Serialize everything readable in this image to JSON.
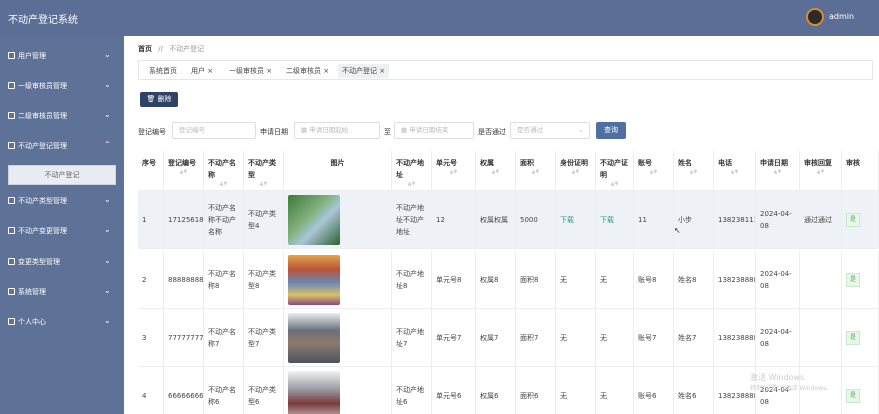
{
  "app": {
    "title": "不动产登记系统",
    "user": "admin"
  },
  "sidebar": {
    "items": [
      {
        "label": "用户管理",
        "icon": "folder-icon",
        "chevron": "⌄"
      },
      {
        "label": "一级审核员管理",
        "icon": "check-icon",
        "chevron": "⌄"
      },
      {
        "label": "二级审核员管理",
        "icon": "check-icon",
        "chevron": "⌄"
      },
      {
        "label": "不动产登记管理",
        "icon": "check-icon",
        "chevron": "⌃"
      },
      {
        "label": "不动产类型管理",
        "icon": "grid-icon",
        "chevron": "⌄"
      },
      {
        "label": "不动产变更管理",
        "icon": "grid-icon",
        "chevron": "⌄"
      },
      {
        "label": "变更类型管理",
        "icon": "grid-icon",
        "chevron": "⌄"
      },
      {
        "label": "系统管理",
        "icon": "grid-icon",
        "chevron": "⌄"
      },
      {
        "label": "个人中心",
        "icon": "grid-icon",
        "chevron": "⌄"
      }
    ],
    "submenu_active": "不动产登记"
  },
  "breadcrumb": {
    "home": "首页",
    "sep": "//",
    "current": "不动产登记"
  },
  "tabs": [
    "系统首页",
    "用户 ×",
    "一级审核员 ×",
    "二级审核员 ×",
    "不动产登记 ×"
  ],
  "toolbar": {
    "delete_label": "删除"
  },
  "search": {
    "label_code": "登记编号",
    "ph_code": "登记编号",
    "label_date": "申请日期",
    "ph_date_start": "申请日期起始",
    "label_to": "至",
    "ph_date_end": "申请日期结束",
    "label_pass": "是否通过",
    "ph_pass": "是否通过",
    "query_label": "查询"
  },
  "table": {
    "headers": [
      "序号",
      "登记编号",
      "不动产名称",
      "不动产类型",
      "图片",
      "不动产地址",
      "单元号",
      "权属",
      "面积",
      "身份证明",
      "不动产证明",
      "账号",
      "姓名",
      "电话",
      "申请日期",
      "审核回复",
      "审核"
    ],
    "rows": [
      {
        "idx": "1",
        "code": "1712561885991",
        "name": "不动产名称不动产名称",
        "type": "不动产类型4",
        "addr": "不动产地址不动产地址",
        "unit": "12",
        "owner": "权属权属",
        "area": "5000",
        "idcard": "下载",
        "cert": "下载",
        "account": "11",
        "person": "小步",
        "phone": "13823811111",
        "date": "2024-04-08",
        "reply": "通过通过",
        "status": "是"
      },
      {
        "idx": "2",
        "code": "8888888888",
        "name": "不动产名称8",
        "type": "不动产类型8",
        "addr": "不动产地址8",
        "unit": "单元号8",
        "owner": "权属8",
        "area": "面积8",
        "idcard": "无",
        "cert": "无",
        "account": "账号8",
        "person": "姓名8",
        "phone": "13823888888",
        "date": "2024-04-08",
        "reply": "",
        "status": "是"
      },
      {
        "idx": "3",
        "code": "7777777777",
        "name": "不动产名称7",
        "type": "不动产类型7",
        "addr": "不动产地址7",
        "unit": "单元号7",
        "owner": "权属7",
        "area": "面积7",
        "idcard": "无",
        "cert": "无",
        "account": "账号7",
        "person": "姓名7",
        "phone": "13823888887",
        "date": "2024-04-08",
        "reply": "",
        "status": "是"
      },
      {
        "idx": "4",
        "code": "6666666666",
        "name": "不动产名称6",
        "type": "不动产类型6",
        "addr": "不动产地址6",
        "unit": "单元号6",
        "owner": "权属6",
        "area": "面积6",
        "idcard": "无",
        "cert": "无",
        "account": "账号6",
        "person": "姓名6",
        "phone": "13823888886",
        "date": "2024-04-08",
        "reply": "",
        "status": "是"
      }
    ]
  },
  "watermark": {
    "line1": "激活 Windows",
    "line2": "转到\"设置\"以激活 Windows。"
  },
  "colors": {
    "topbar": "#5a6e96",
    "sidebar": "#5e7297",
    "accent": "#2f4366",
    "link": "#2b9c8b"
  }
}
